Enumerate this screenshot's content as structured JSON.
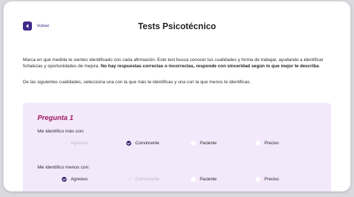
{
  "header": {
    "back_label": "Volver",
    "title": "Tests Psicotécnico"
  },
  "intro": {
    "text_plain": "Marca en qué medida te sientes identificado con cada afirmación. Este test busca conocer tus cualidades y forma de trabajar, ayudando a identificar fortalezas y oportunidades de mejora. ",
    "text_bold": "No hay respuestas correctas o incorrectas, responde con sinceridad según lo que mejor te describa",
    "text_end": "."
  },
  "instruction": "De las siguientes cualidades, selecciona una con la que más te identificas y una con la que menos te identificas.",
  "question": {
    "title": "Pregunta 1",
    "most": {
      "label": "Me identifico más con:",
      "options": [
        {
          "label": "Agresivo",
          "state": "disabled"
        },
        {
          "label": "Convincente",
          "state": "checked"
        },
        {
          "label": "Paciente",
          "state": "unchecked"
        },
        {
          "label": "Preciso",
          "state": "unchecked"
        }
      ]
    },
    "least": {
      "label": "Me identifico menos con:",
      "options": [
        {
          "label": "Agresivo",
          "state": "checked"
        },
        {
          "label": "Convincente",
          "state": "disabled"
        },
        {
          "label": "Paciente",
          "state": "unchecked"
        },
        {
          "label": "Preciso",
          "state": "unchecked"
        }
      ]
    }
  },
  "colors": {
    "accent": "#3f2a8c",
    "question_title": "#9b1a5e",
    "panel_bg": "#f3e9fb",
    "radio_checked": "#2e1f66"
  },
  "icons": {
    "back": "arrow-left-icon",
    "check": "check-icon"
  }
}
